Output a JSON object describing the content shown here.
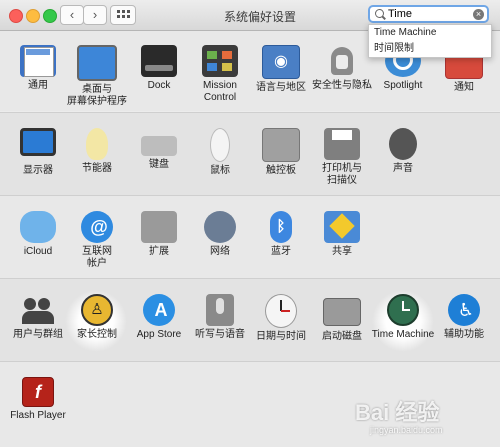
{
  "window": {
    "title": "系统偏好设置"
  },
  "toolbar": {
    "back": "‹",
    "forward": "›"
  },
  "search": {
    "value": "Time",
    "clear": "×"
  },
  "dropdown": {
    "items": [
      "Time Machine",
      "时间限制"
    ]
  },
  "rows": [
    [
      {
        "label": "通用",
        "icon": "general-icon",
        "color": "#3c72c4"
      },
      {
        "label": "桌面与\n屏幕保护程序",
        "icon": "desktop-icon",
        "color": "#3d86d8"
      },
      {
        "label": "Dock",
        "icon": "dock-icon",
        "color": "#2a2a2a"
      },
      {
        "label": "Mission\nControl",
        "icon": "mission-control-icon",
        "color": "#3b3b3b"
      },
      {
        "label": "语言与地区",
        "icon": "language-icon",
        "color": "#4a7fc5"
      },
      {
        "label": "安全性与隐私",
        "icon": "security-icon",
        "color": "#8a8a8a"
      },
      {
        "label": "Spotlight",
        "icon": "spotlight-icon",
        "color": "#3b8cd6"
      },
      {
        "label": "通知",
        "icon": "notification-icon",
        "color": "#d74a3c"
      }
    ],
    [
      {
        "label": "显示器",
        "icon": "display-icon",
        "color": "#2b7bd4"
      },
      {
        "label": "节能器",
        "icon": "energy-icon",
        "color": "#f3e7a5"
      },
      {
        "label": "键盘",
        "icon": "keyboard-icon",
        "color": "#bdbdbd"
      },
      {
        "label": "鼠标",
        "icon": "mouse-icon",
        "color": "#e8e8e8"
      },
      {
        "label": "触控板",
        "icon": "trackpad-icon",
        "color": "#a0a0a0"
      },
      {
        "label": "打印机与\n扫描仪",
        "icon": "printer-icon",
        "color": "#7f7f7f"
      },
      {
        "label": "声音",
        "icon": "sound-icon",
        "color": "#555555"
      }
    ],
    [
      {
        "label": "iCloud",
        "icon": "icloud-icon",
        "color": "#6fb3ea"
      },
      {
        "label": "互联网\n帐户",
        "icon": "internet-accounts-icon",
        "color": "#2f8ae0"
      },
      {
        "label": "扩展",
        "icon": "extensions-icon",
        "color": "#9a9a9a"
      },
      {
        "label": "网络",
        "icon": "network-icon",
        "color": "#6b7d95"
      },
      {
        "label": "蓝牙",
        "icon": "bluetooth-icon",
        "color": "#3d87e0"
      },
      {
        "label": "共享",
        "icon": "sharing-icon",
        "color": "#4a8ad6"
      }
    ],
    [
      {
        "label": "用户与群组",
        "icon": "users-icon",
        "color": "#444444"
      },
      {
        "label": "家长控制",
        "icon": "parental-controls-icon",
        "color": "#e8b731"
      },
      {
        "label": "App Store",
        "icon": "app-store-icon",
        "color": "#2b8fe3"
      },
      {
        "label": "听写与语音",
        "icon": "dictation-icon",
        "color": "#8a8a8a"
      },
      {
        "label": "日期与时间",
        "icon": "date-time-icon",
        "color": "#d9d9d9"
      },
      {
        "label": "启动磁盘",
        "icon": "startup-disk-icon",
        "color": "#9a9a9a"
      },
      {
        "label": "Time Machine",
        "icon": "time-machine-icon",
        "color": "#2f6f4f"
      },
      {
        "label": "辅助功能",
        "icon": "accessibility-icon",
        "color": "#1e7fd6"
      }
    ],
    [
      {
        "label": "Flash Player",
        "icon": "flash-player-icon",
        "color": "#b5231a"
      }
    ]
  ],
  "watermark": {
    "brand": "Bai 经验",
    "url": "jingyan.baidu.com"
  }
}
